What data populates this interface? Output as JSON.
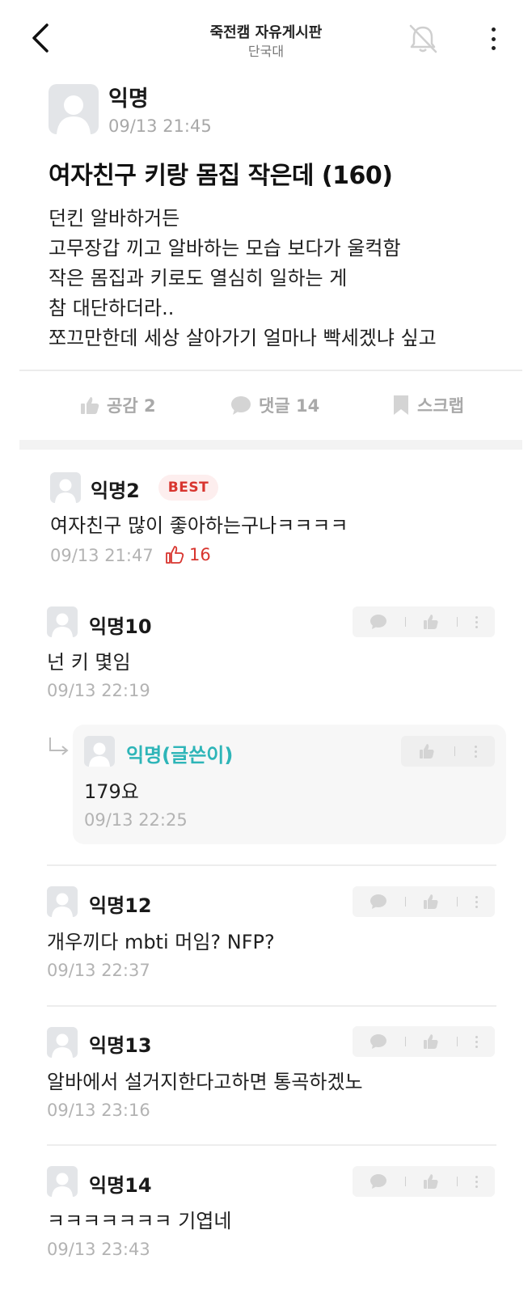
{
  "header": {
    "title": "죽전캠 자유게시판",
    "subtitle": "단국대"
  },
  "post": {
    "author": "익명",
    "time": "09/13 21:45",
    "title": "여자친구 키랑 몸집 작은데 (160)",
    "body_lines": [
      "던킨 알바하거든",
      "고무장갑 끼고 알바하는 모습 보다가 울컥함",
      "작은 몸집과 키로도 열심히 일하는 게",
      "참 대단하더라..",
      "쪼끄만한데 세상 살아가기 얼마나 빡세겠냐 싶고"
    ]
  },
  "actions": {
    "like_label": "공감 2",
    "comment_label": "댓글 14",
    "scrap_label": "스크랩"
  },
  "comments": [
    {
      "author": "익명2",
      "badge": "BEST",
      "text": "여자친구 많이 좋아하는구나ㅋㅋㅋㅋ",
      "time": "09/13 21:47",
      "likes": "16"
    },
    {
      "author": "익명10",
      "text": "넌 키 몇임",
      "time": "09/13 22:19"
    },
    {
      "author": "익명(글쓴이)",
      "text": "179요",
      "time": "09/13 22:25",
      "is_reply": true
    },
    {
      "author": "익명12",
      "text": "개우끼다 mbti 머임? NFP?",
      "time": "09/13 22:37"
    },
    {
      "author": "익명13",
      "text": "알바에서 설거지한다고하면 통곡하겠노",
      "time": "09/13 23:16"
    },
    {
      "author": "익명14",
      "text": "ㅋㅋㅋㅋㅋㅋㅋ 기엽네",
      "time": "09/13 23:43"
    }
  ],
  "colors": {
    "best_red": "#d8352f",
    "writer_teal": "#2eb5b8",
    "muted_gray": "#b3b3b3"
  }
}
